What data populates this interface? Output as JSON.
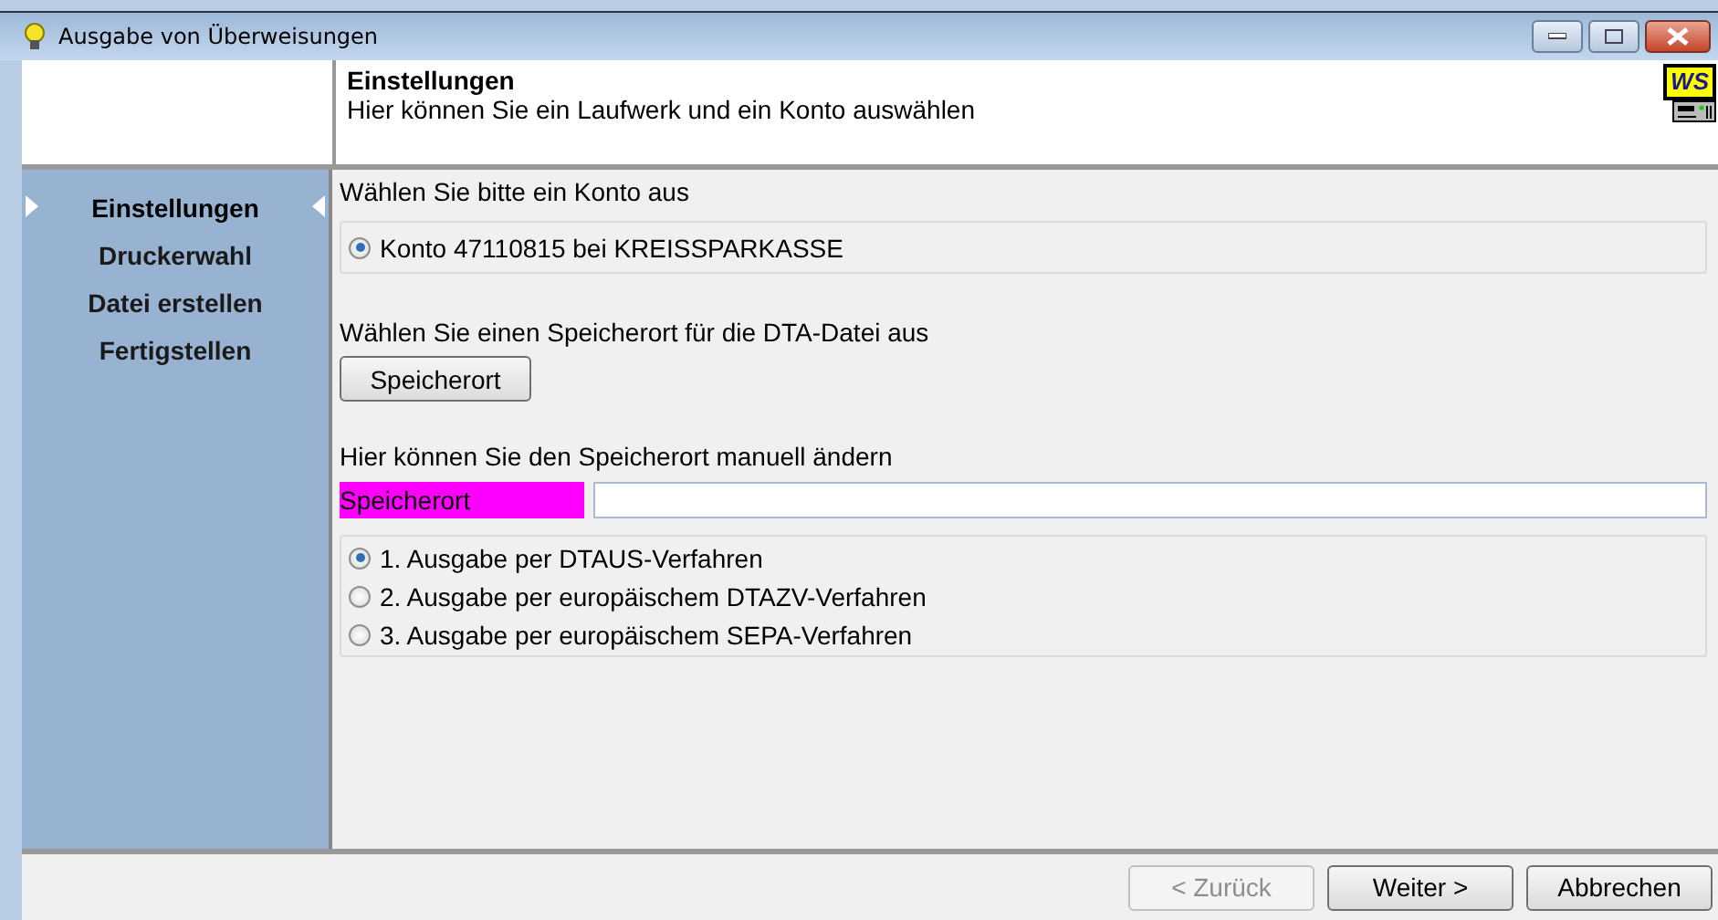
{
  "window": {
    "title": "Ausgabe von Überweisungen"
  },
  "header": {
    "title": "Einstellungen",
    "subtitle": "Hier können Sie ein Laufwerk und ein Konto auswählen",
    "logo": "WS"
  },
  "steps": [
    {
      "label": "Einstellungen",
      "selected": true
    },
    {
      "label": "Druckerwahl",
      "selected": false
    },
    {
      "label": "Datei erstellen",
      "selected": false
    },
    {
      "label": "Fertigstellen",
      "selected": false
    }
  ],
  "account_section": {
    "label": "Wählen Sie bitte ein Konto aus",
    "accounts": [
      {
        "label": "Konto 47110815 bei KREISSPARKASSE",
        "selected": true
      }
    ]
  },
  "location_section": {
    "label": "Wählen Sie einen Speicherort für die DTA-Datei aus",
    "button": "Speicherort"
  },
  "manual_section": {
    "label": "Hier können Sie den Speicherort manuell ändern",
    "field_label": "Speicherort"
  },
  "formats": [
    {
      "label": "1. Ausgabe per DTAUS-Verfahren",
      "selected": true
    },
    {
      "label": "2. Ausgabe per europäischem DTAZV-Verfahren",
      "selected": false
    },
    {
      "label": "3. Ausgabe per europäischem SEPA-Verfahren",
      "selected": false
    }
  ],
  "buttons": [
    {
      "label": "< Zurück",
      "disabled": true
    },
    {
      "label": "Weiter >",
      "disabled": false
    },
    {
      "label": "Abbrechen",
      "disabled": false
    }
  ]
}
